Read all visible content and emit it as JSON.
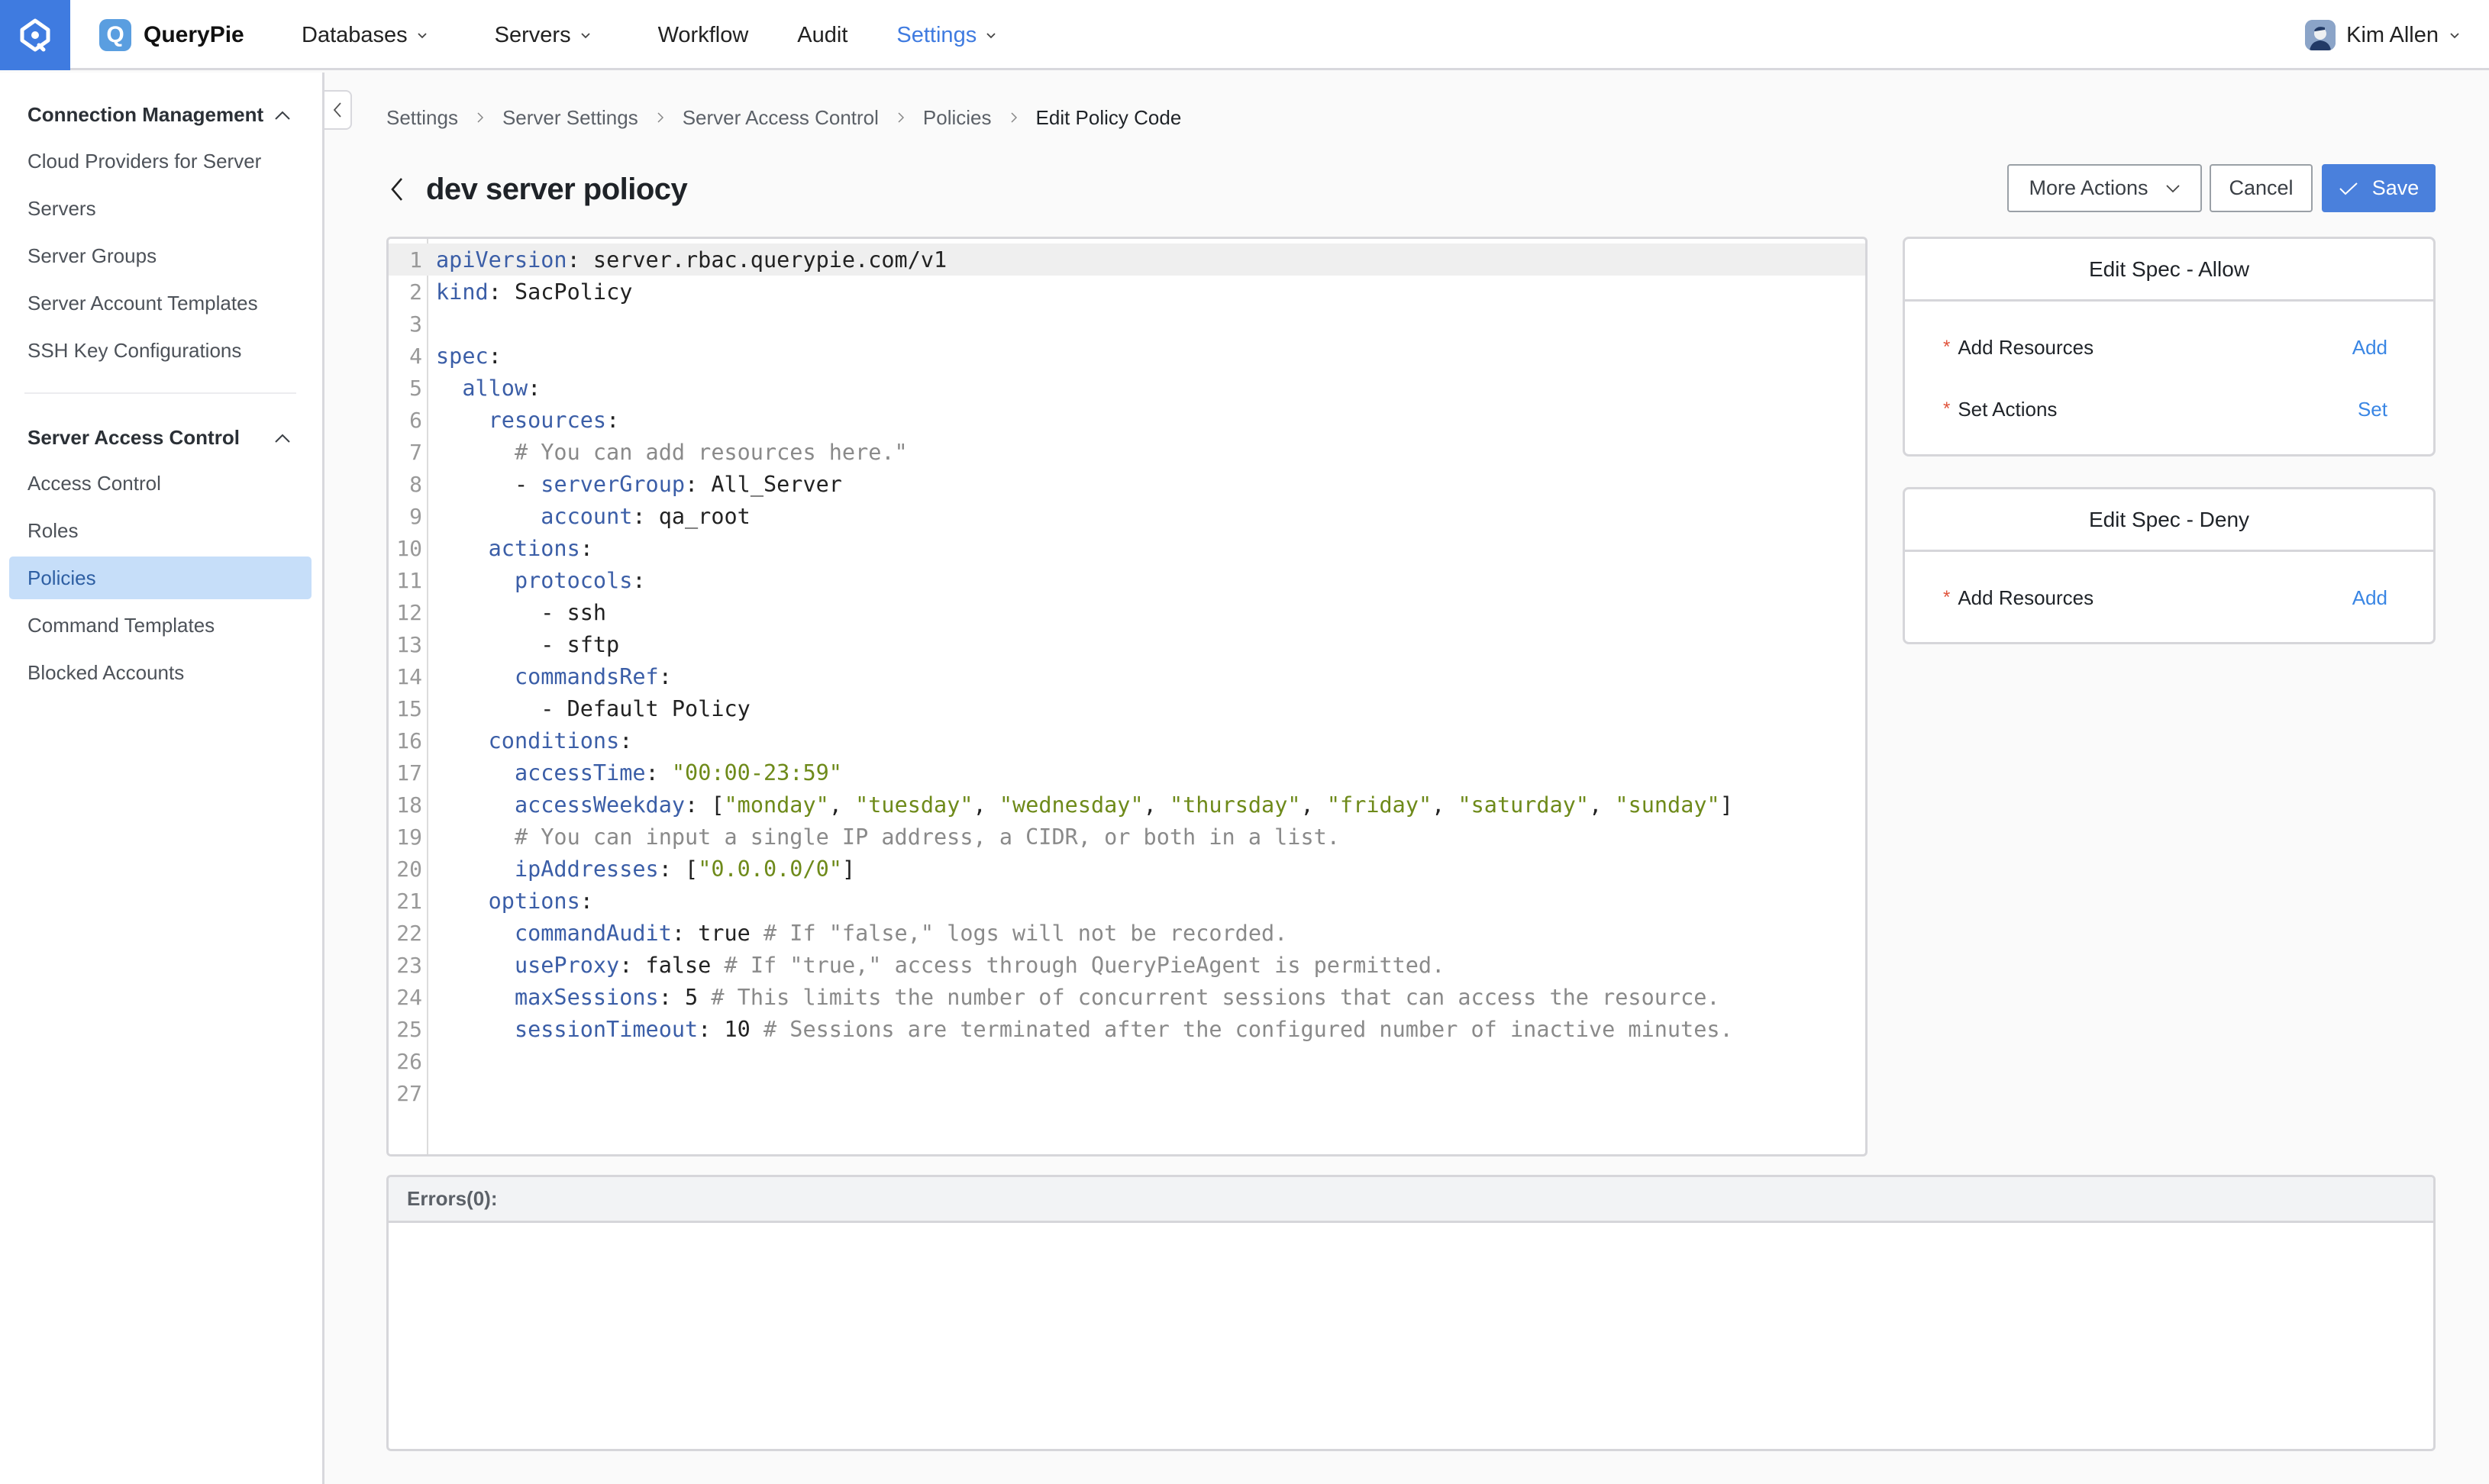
{
  "header": {
    "app_name": "QueryPie",
    "app_logo_letter": "Q",
    "nav": [
      {
        "label": "Databases",
        "has_dropdown": true,
        "active": false
      },
      {
        "label": "Servers",
        "has_dropdown": true,
        "active": false
      },
      {
        "label": "Workflow",
        "has_dropdown": false,
        "active": false
      },
      {
        "label": "Audit",
        "has_dropdown": false,
        "active": false
      },
      {
        "label": "Settings",
        "has_dropdown": true,
        "active": true
      }
    ],
    "user_name": "Kim Allen"
  },
  "sidebar": {
    "groups": [
      {
        "title": "Connection Management",
        "expanded": true,
        "items": [
          {
            "label": "Cloud Providers for Server",
            "active": false
          },
          {
            "label": "Servers",
            "active": false
          },
          {
            "label": "Server Groups",
            "active": false
          },
          {
            "label": "Server Account Templates",
            "active": false
          },
          {
            "label": "SSH Key Configurations",
            "active": false
          }
        ]
      },
      {
        "title": "Server Access Control",
        "expanded": true,
        "items": [
          {
            "label": "Access Control",
            "active": false
          },
          {
            "label": "Roles",
            "active": false
          },
          {
            "label": "Policies",
            "active": true
          },
          {
            "label": "Command Templates",
            "active": false
          },
          {
            "label": "Blocked Accounts",
            "active": false
          }
        ]
      }
    ]
  },
  "breadcrumb": [
    "Settings",
    "Server Settings",
    "Server Access Control",
    "Policies",
    "Edit Policy Code"
  ],
  "page": {
    "title": "dev server poliocy",
    "buttons": {
      "more_actions": "More Actions",
      "cancel": "Cancel",
      "save": "Save"
    }
  },
  "editor": {
    "active_line": 1,
    "lines": [
      [
        {
          "t": "key",
          "v": "apiVersion"
        },
        {
          "t": "plain",
          "v": ": server.rbac.querypie.com/v1"
        }
      ],
      [
        {
          "t": "key",
          "v": "kind"
        },
        {
          "t": "plain",
          "v": ": SacPolicy"
        }
      ],
      [],
      [
        {
          "t": "key",
          "v": "spec"
        },
        {
          "t": "plain",
          "v": ":"
        }
      ],
      [
        {
          "t": "plain",
          "v": "  "
        },
        {
          "t": "key",
          "v": "allow"
        },
        {
          "t": "plain",
          "v": ":"
        }
      ],
      [
        {
          "t": "plain",
          "v": "    "
        },
        {
          "t": "key",
          "v": "resources"
        },
        {
          "t": "plain",
          "v": ":"
        }
      ],
      [
        {
          "t": "plain",
          "v": "      "
        },
        {
          "t": "com",
          "v": "# You can add resources here.\""
        }
      ],
      [
        {
          "t": "plain",
          "v": "      - "
        },
        {
          "t": "key",
          "v": "serverGroup"
        },
        {
          "t": "plain",
          "v": ": All_Server"
        }
      ],
      [
        {
          "t": "plain",
          "v": "        "
        },
        {
          "t": "key",
          "v": "account"
        },
        {
          "t": "plain",
          "v": ": qa_root"
        }
      ],
      [
        {
          "t": "plain",
          "v": "    "
        },
        {
          "t": "key",
          "v": "actions"
        },
        {
          "t": "plain",
          "v": ":"
        }
      ],
      [
        {
          "t": "plain",
          "v": "      "
        },
        {
          "t": "key",
          "v": "protocols"
        },
        {
          "t": "plain",
          "v": ":"
        }
      ],
      [
        {
          "t": "plain",
          "v": "        - ssh"
        }
      ],
      [
        {
          "t": "plain",
          "v": "        - sftp"
        }
      ],
      [
        {
          "t": "plain",
          "v": "      "
        },
        {
          "t": "key",
          "v": "commandsRef"
        },
        {
          "t": "plain",
          "v": ":"
        }
      ],
      [
        {
          "t": "plain",
          "v": "        - Default Policy"
        }
      ],
      [
        {
          "t": "plain",
          "v": "    "
        },
        {
          "t": "key",
          "v": "conditions"
        },
        {
          "t": "plain",
          "v": ":"
        }
      ],
      [
        {
          "t": "plain",
          "v": "      "
        },
        {
          "t": "key",
          "v": "accessTime"
        },
        {
          "t": "plain",
          "v": ": "
        },
        {
          "t": "str",
          "v": "\"00:00-23:59\""
        }
      ],
      [
        {
          "t": "plain",
          "v": "      "
        },
        {
          "t": "key",
          "v": "accessWeekday"
        },
        {
          "t": "plain",
          "v": ": ["
        },
        {
          "t": "str",
          "v": "\"monday\""
        },
        {
          "t": "plain",
          "v": ", "
        },
        {
          "t": "str",
          "v": "\"tuesday\""
        },
        {
          "t": "plain",
          "v": ", "
        },
        {
          "t": "str",
          "v": "\"wednesday\""
        },
        {
          "t": "plain",
          "v": ", "
        },
        {
          "t": "str",
          "v": "\"thursday\""
        },
        {
          "t": "plain",
          "v": ", "
        },
        {
          "t": "str",
          "v": "\"friday\""
        },
        {
          "t": "plain",
          "v": ", "
        },
        {
          "t": "str",
          "v": "\"saturday\""
        },
        {
          "t": "plain",
          "v": ", "
        },
        {
          "t": "str",
          "v": "\"sunday\""
        },
        {
          "t": "plain",
          "v": "]"
        }
      ],
      [
        {
          "t": "plain",
          "v": "      "
        },
        {
          "t": "com",
          "v": "# You can input a single IP address, a CIDR, or both in a list."
        }
      ],
      [
        {
          "t": "plain",
          "v": "      "
        },
        {
          "t": "key",
          "v": "ipAddresses"
        },
        {
          "t": "plain",
          "v": ": ["
        },
        {
          "t": "str",
          "v": "\"0.0.0.0/0\""
        },
        {
          "t": "plain",
          "v": "]"
        }
      ],
      [
        {
          "t": "plain",
          "v": "    "
        },
        {
          "t": "key",
          "v": "options"
        },
        {
          "t": "plain",
          "v": ":"
        }
      ],
      [
        {
          "t": "plain",
          "v": "      "
        },
        {
          "t": "key",
          "v": "commandAudit"
        },
        {
          "t": "plain",
          "v": ": true "
        },
        {
          "t": "com",
          "v": "# If \"false,\" logs will not be recorded."
        }
      ],
      [
        {
          "t": "plain",
          "v": "      "
        },
        {
          "t": "key",
          "v": "useProxy"
        },
        {
          "t": "plain",
          "v": ": false "
        },
        {
          "t": "com",
          "v": "# If \"true,\" access through QueryPieAgent is permitted."
        }
      ],
      [
        {
          "t": "plain",
          "v": "      "
        },
        {
          "t": "key",
          "v": "maxSessions"
        },
        {
          "t": "plain",
          "v": ": 5 "
        },
        {
          "t": "com",
          "v": "# This limits the number of concurrent sessions that can access the resource."
        }
      ],
      [
        {
          "t": "plain",
          "v": "      "
        },
        {
          "t": "key",
          "v": "sessionTimeout"
        },
        {
          "t": "plain",
          "v": ": 10 "
        },
        {
          "t": "com",
          "v": "# Sessions are terminated after the configured number of inactive minutes."
        }
      ],
      [],
      []
    ]
  },
  "spec_allow": {
    "title": "Edit Spec - Allow",
    "rows": [
      {
        "label": "Add Resources",
        "required": true,
        "action": "Add"
      },
      {
        "label": "Set Actions",
        "required": true,
        "action": "Set"
      }
    ]
  },
  "spec_deny": {
    "title": "Edit Spec - Deny",
    "rows": [
      {
        "label": "Add Resources",
        "required": true,
        "action": "Add"
      }
    ]
  },
  "errors": {
    "label": "Errors(0):"
  },
  "colors": {
    "brand": "#3f7be0",
    "primary_button": "#4a80dc",
    "link": "#3a86e4",
    "active_nav_item_bg": "#c6def9",
    "required_asterisk": "#e0533b",
    "yaml_key": "#3b5ea7",
    "yaml_string": "#6e8a1a",
    "yaml_comment": "#8a8a8a"
  }
}
